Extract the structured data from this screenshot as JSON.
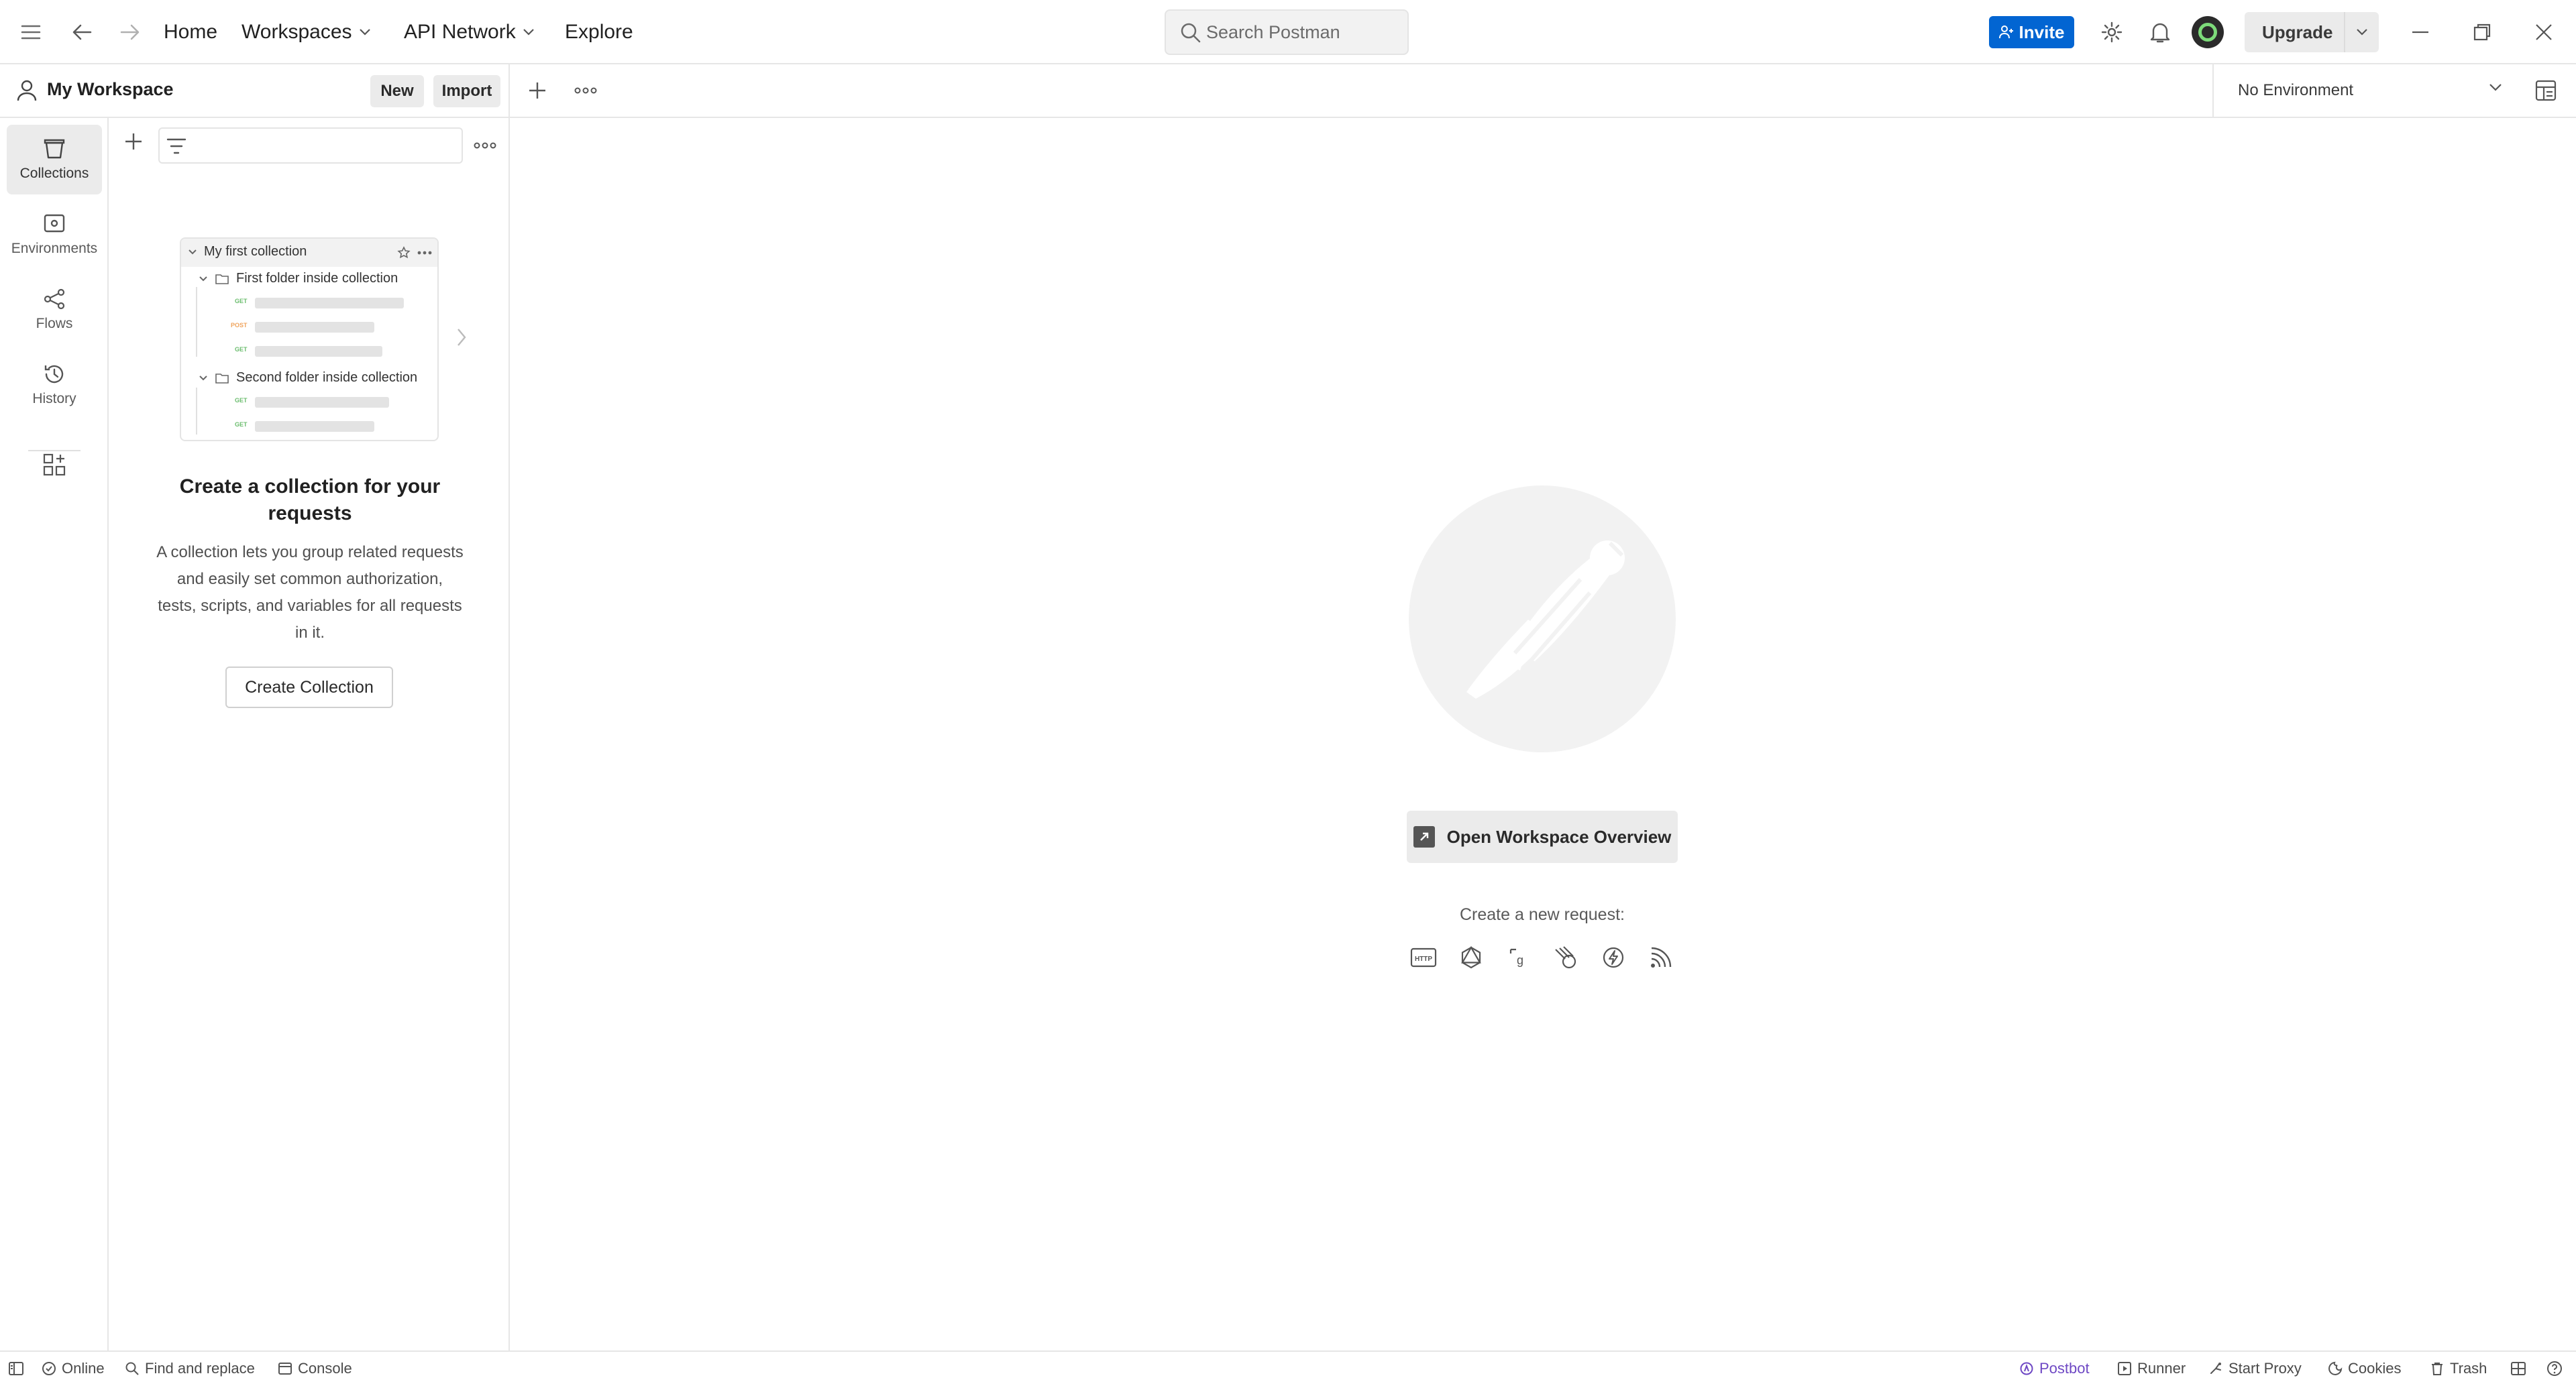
{
  "header": {
    "nav": {
      "home": "Home",
      "workspaces": "Workspaces",
      "api_network": "API Network",
      "explore": "Explore"
    },
    "search_placeholder": "Search Postman",
    "invite_label": "Invite",
    "upgrade_label": "Upgrade",
    "icons": [
      "menu-icon",
      "back-arrow-icon",
      "forward-arrow-icon",
      "settings-gear-icon",
      "bell-icon",
      "avatar",
      "minimize-icon",
      "restore-icon",
      "close-icon"
    ]
  },
  "workspace": {
    "title": "My Workspace",
    "new_label": "New",
    "import_label": "Import"
  },
  "environment": {
    "selected": "No Environment"
  },
  "rail": {
    "items": [
      {
        "label": "Collections",
        "active": true
      },
      {
        "label": "Environments",
        "active": false
      },
      {
        "label": "Flows",
        "active": false
      },
      {
        "label": "History",
        "active": false
      }
    ]
  },
  "collection_preview": {
    "collection_name": "My first collection",
    "folder_1": "First folder inside collection",
    "folder_2": "Second folder inside collection",
    "methods": [
      "GET",
      "POST",
      "GET",
      "GET",
      "GET"
    ]
  },
  "empty_state": {
    "title": "Create a collection for your requests",
    "description": "A collection lets you group related requests and easily set common authorization, tests, scripts, and variables for all requests in it.",
    "button": "Create Collection"
  },
  "main": {
    "overview_button": "Open Workspace Overview",
    "new_request_label": "Create a new request:",
    "request_types": [
      "HTTP",
      "GraphQL",
      "gRPC",
      "WebSocket",
      "Socket.IO",
      "MQTT"
    ]
  },
  "status_bar": {
    "online": "Online",
    "find_replace": "Find and replace",
    "console": "Console",
    "postbot": "Postbot",
    "runner": "Runner",
    "start_proxy": "Start Proxy",
    "cookies": "Cookies",
    "trash": "Trash"
  },
  "colors": {
    "accent": "#0265d2",
    "postbot": "#6e48c4",
    "post_method": "#f0a45d",
    "get_method": "#6bbd6e"
  }
}
